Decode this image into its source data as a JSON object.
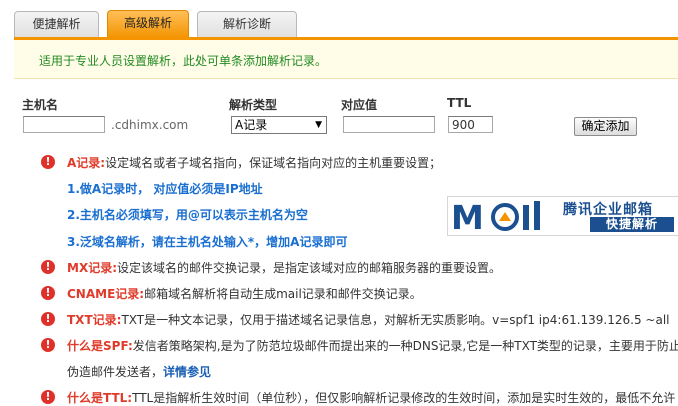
{
  "tabs": [
    {
      "label": "便捷解析",
      "active": false
    },
    {
      "label": "高级解析",
      "active": true
    },
    {
      "label": "解析诊断",
      "active": false
    }
  ],
  "notice": "适用于专业人员设置解析，此处可单条添加解析记录。",
  "form": {
    "host_label": "主机名",
    "host_value": "",
    "domain_suffix": ".cdhimx.com",
    "type_label": "解析类型",
    "type_selected": "A记录",
    "value_label": "对应值",
    "value_value": "",
    "ttl_label": "TTL",
    "ttl_value": "900",
    "submit_label": "确定添加"
  },
  "help": {
    "a_record": {
      "key": "A记录:",
      "text": "设定域名或者子域名指向，保证域名指向对应的主机重要设置；"
    },
    "a_notes": [
      "1.做A记录时， 对应值必须是IP地址",
      "2.主机名必须填写，用@可以表示主机名为空",
      "3.泛域名解析，请在主机名处输入*，增加A记录即可"
    ],
    "mx": {
      "key": "MX记录:",
      "text": "设定该域名的邮件交换记录，是指定该域对应的邮箱服务器的重要设置。"
    },
    "cname": {
      "key": "CNAME记录:",
      "text": "邮箱域名解析将自动生成mail记录和邮件交换记录。"
    },
    "txt": {
      "key": "TXT记录:",
      "text": "TXT是一种文本记录，仅用于描述域名记录信息，对解析无实质影响。v=spf1 ip4:61.139.126.5 ~all"
    },
    "spf": {
      "key": "什么是SPF:",
      "text": "发信者策略架构,是为了防范垃圾邮件而提出来的一种DNS记录,它是一种TXT类型的记录，主要用于防止",
      "line2": "伪造邮件发送者，",
      "link": "详情参见"
    },
    "ttl": {
      "key": "什么是TTL:",
      "text": "TTL是指解析生效时间（单位秒），但仅影响解析记录修改的生效时间，添加是实时生效的，最低不允许"
    }
  },
  "banner": {
    "logo": "MOil",
    "title": "腾讯企业邮箱",
    "subtitle": "快捷解析"
  },
  "colors": {
    "accent": "#f39400",
    "warning": "#e0302a",
    "link": "#1a6fd0",
    "notice": "#228b22"
  }
}
